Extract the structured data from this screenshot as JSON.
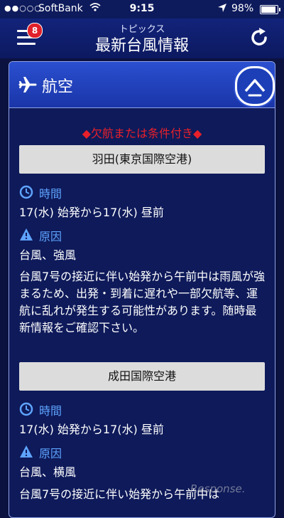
{
  "status_bar": {
    "signal": "●●○○○",
    "carrier": "SoftBank",
    "time": "9:15",
    "battery": "98%",
    "battery_level": 0.98
  },
  "header": {
    "subtitle": "トピックス",
    "title": "最新台風情報",
    "badge_count": "8"
  },
  "section": {
    "title": "航空",
    "notice": "◆欠航または条件付き◆"
  },
  "airports": [
    {
      "name": "羽田(東京国際空港)",
      "time_label": "時間",
      "time_value": "17(水) 始発から17(水) 昼前",
      "cause_label": "原因",
      "cause_value": "台風、強風",
      "detail": "台風7号の接近に伴い始発から午前中は雨風が強まるため、出発・到着に遅れや一部欠航等、運航に乱れが発生する可能性があります。随時最新情報をご確認下さい。"
    },
    {
      "name": "成田国際空港",
      "time_label": "時間",
      "time_value": "17(水) 始発から17(水) 昼前",
      "cause_label": "原因",
      "cause_value": "台風、横風",
      "detail": "台風7号の接近に伴い始発から午前中は"
    }
  ],
  "watermark": "Response.",
  "colors": {
    "background": "#0b1240",
    "header": "#13237a",
    "section_header": "#2a4fd0",
    "notice": "#e8202a",
    "label": "#5fa4ff",
    "airport_bar": "#dcdcdc",
    "badge": "#e0202a"
  },
  "icons": [
    "menu-icon",
    "refresh-icon",
    "plane-icon",
    "chevron-up-icon",
    "clock-icon",
    "warning-icon"
  ]
}
